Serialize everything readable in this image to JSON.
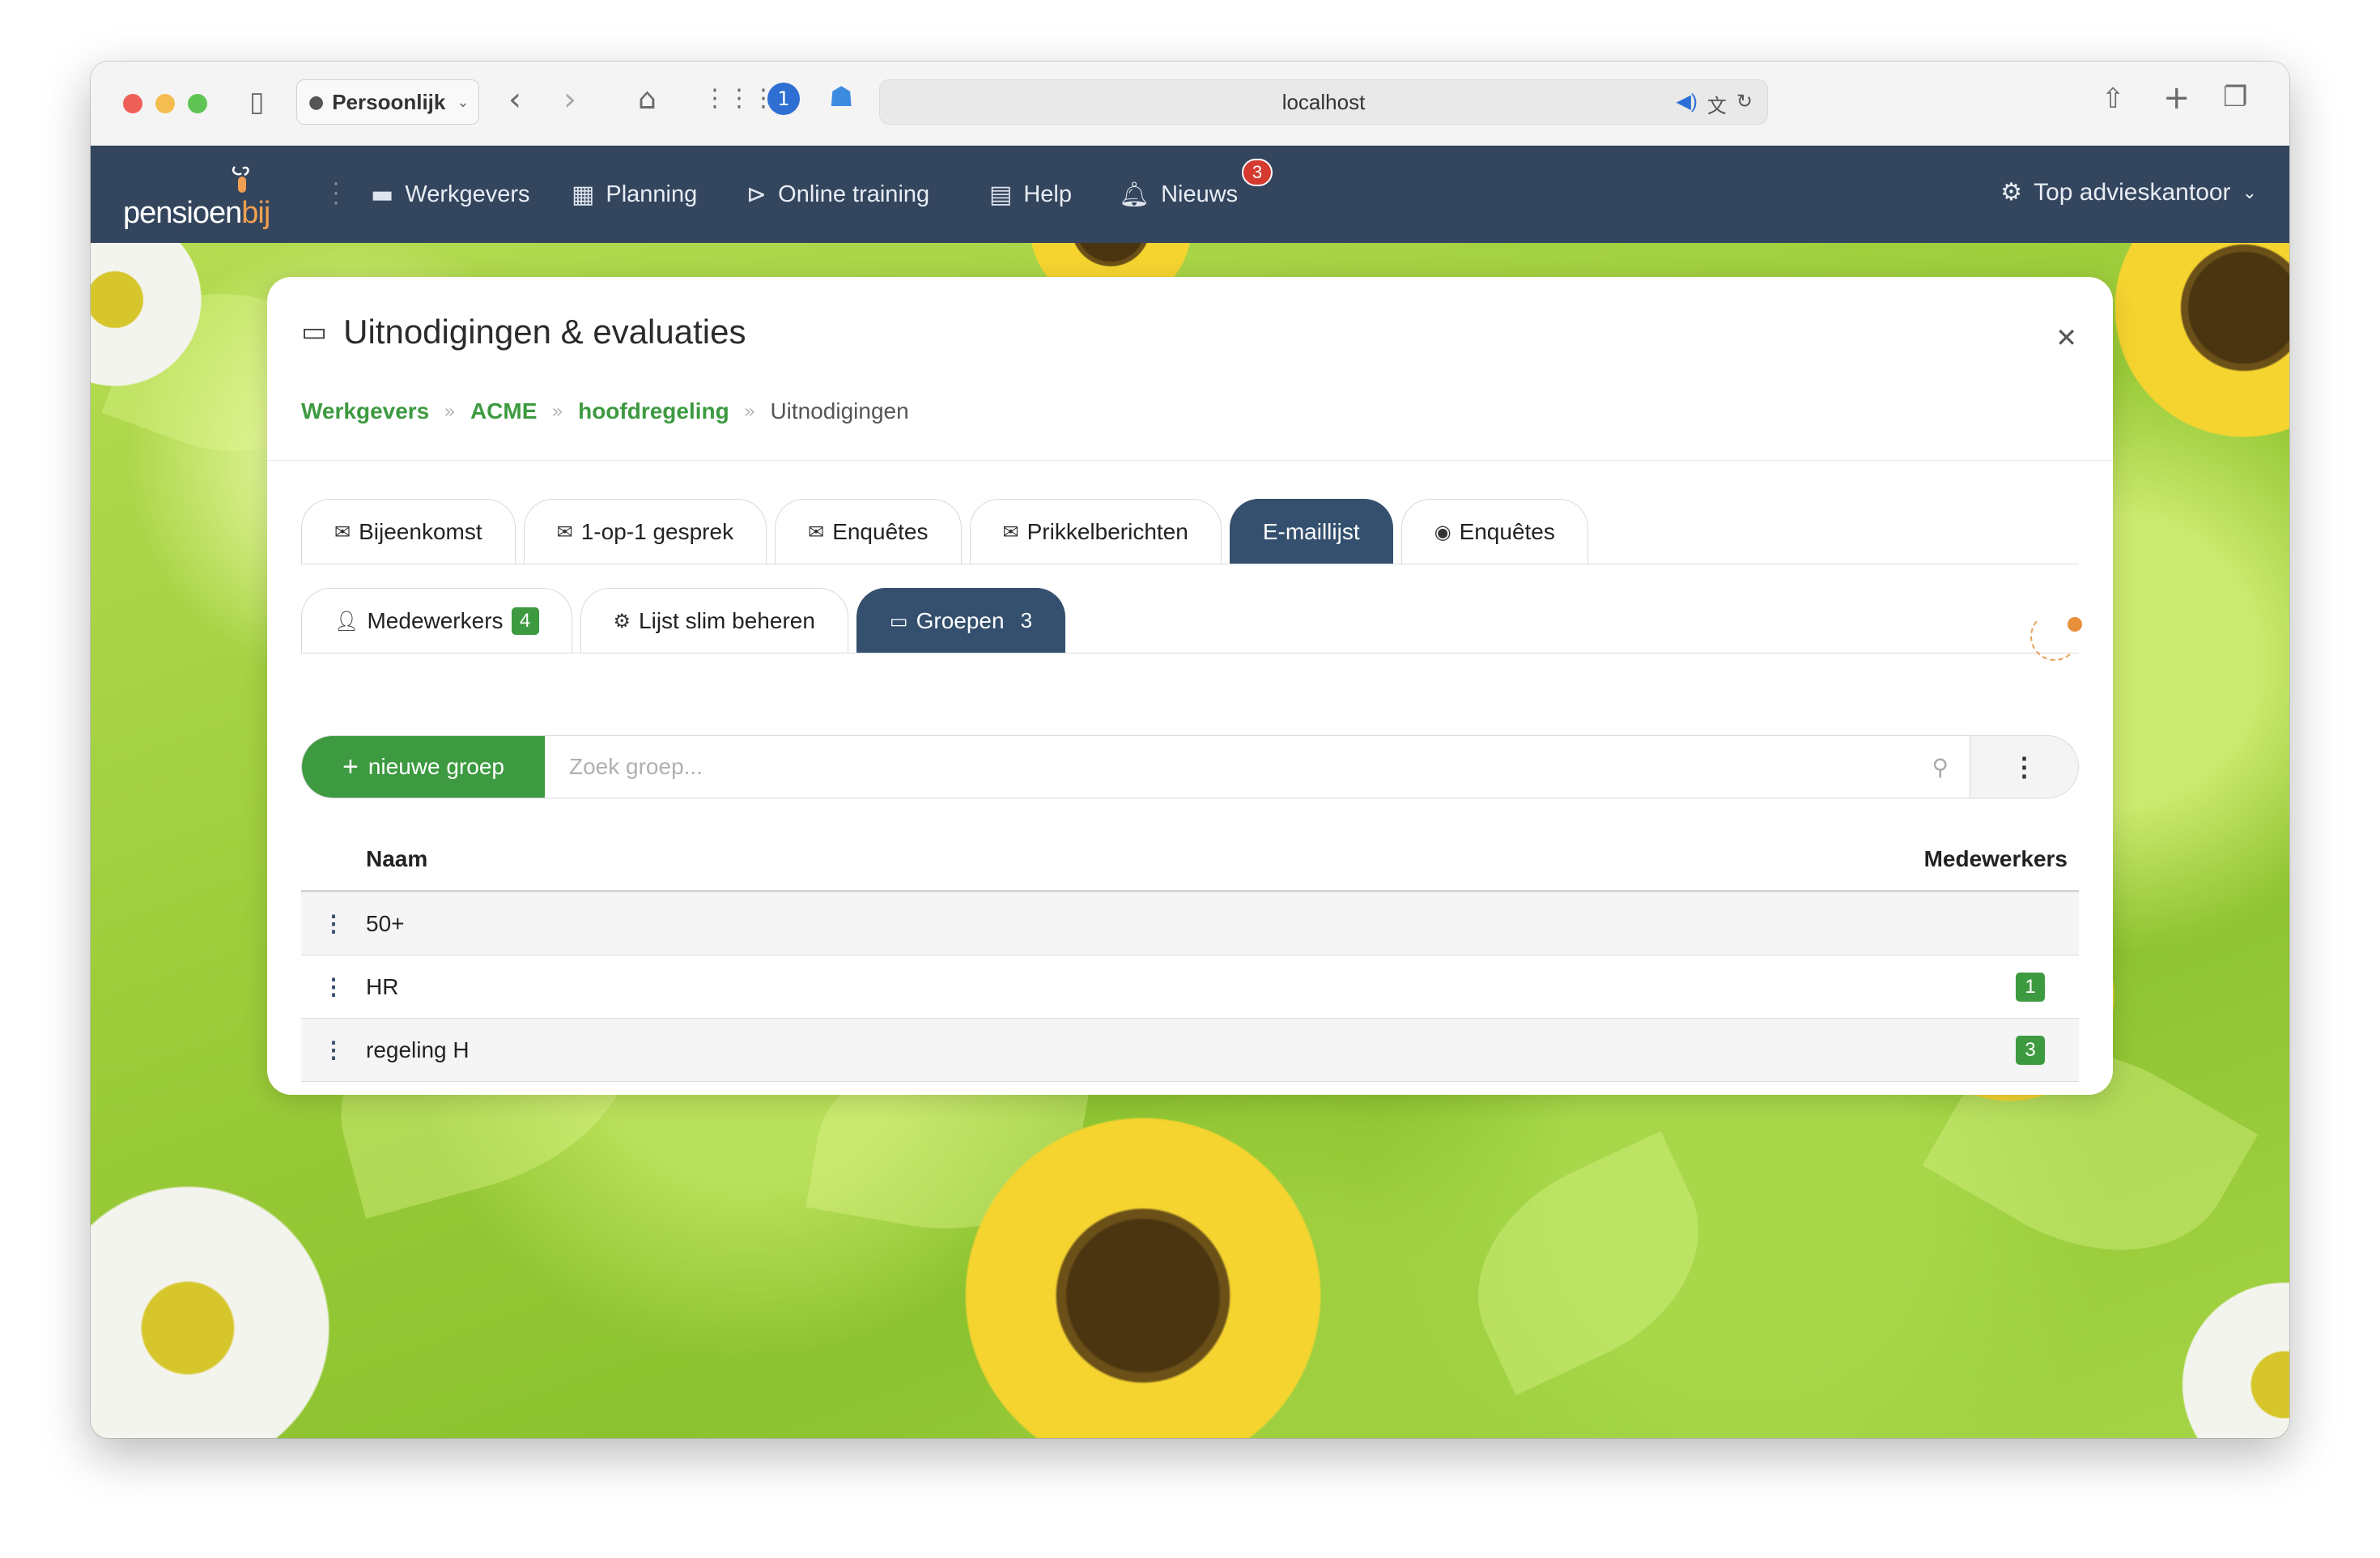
{
  "browser": {
    "profile": "Persoonlijk",
    "url": "localhost"
  },
  "nav": {
    "logo_main": "pensioen",
    "logo_accent": "bij",
    "items": [
      {
        "label": "Werkgevers",
        "icon": "briefcase-icon"
      },
      {
        "label": "Planning",
        "icon": "calendar-icon"
      },
      {
        "label": "Online training",
        "icon": "play-circle-icon"
      },
      {
        "label": "Help",
        "icon": "book-icon"
      },
      {
        "label": "Nieuws",
        "icon": "bell-icon"
      }
    ],
    "news_badge": "3",
    "office": "Top advieskantoor"
  },
  "modal": {
    "title": "Uitnodigingen & evaluaties",
    "breadcrumb": [
      "Werkgevers",
      "ACME",
      "hoofdregeling",
      "Uitnodigingen"
    ],
    "tabs_top": [
      {
        "label": "Bijeenkomst",
        "icon": "mail-icon"
      },
      {
        "label": "1-op-1 gesprek",
        "icon": "mail-icon"
      },
      {
        "label": "Enquêtes",
        "icon": "mail-icon"
      },
      {
        "label": "Prikkelberichten",
        "icon": "mail-icon"
      },
      {
        "label": "E-maillijst",
        "icon": "",
        "active": true
      },
      {
        "label": "Enquêtes",
        "icon": "eye-icon"
      }
    ],
    "tabs_sub": [
      {
        "label": "Medewerkers",
        "count": "4"
      },
      {
        "label": "Lijst slim beheren"
      },
      {
        "label": "Groepen",
        "count": "3",
        "active": true
      }
    ],
    "new_group_label": "nieuwe groep",
    "search_placeholder": "Zoek groep...",
    "table": {
      "headers": {
        "name": "Naam",
        "count": "Medewerkers"
      },
      "rows": [
        {
          "name": "50+",
          "count": ""
        },
        {
          "name": "HR",
          "count": "1"
        },
        {
          "name": "regeling H",
          "count": "3"
        }
      ]
    }
  },
  "colors": {
    "navbar": "#34455e",
    "active_tab": "#34506e",
    "green": "#3d9a40",
    "news_badge": "#d43a2f"
  }
}
